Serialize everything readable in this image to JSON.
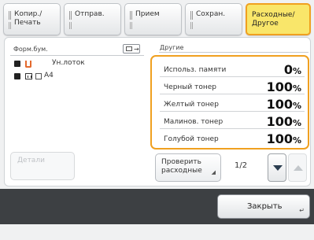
{
  "tabs": [
    {
      "line1": "Копир./",
      "line2": "Печать"
    },
    {
      "line1": "Отправ.",
      "line2": ""
    },
    {
      "line1": "Прием",
      "line2": ""
    },
    {
      "line1": "Сохран.",
      "line2": ""
    },
    {
      "line1": "Расходные/",
      "line2": "Другое"
    }
  ],
  "left_panel": {
    "title": "Форм.бум.",
    "trays": [
      {
        "label": "Ун.лоток"
      },
      {
        "label": "A4"
      }
    ],
    "details_label": "Детали"
  },
  "right_panel": {
    "title": "Другие",
    "rows": [
      {
        "name": "Использ. памяти",
        "value": "0",
        "unit": "%"
      },
      {
        "name": "Черный тонер",
        "value": "100",
        "unit": "%"
      },
      {
        "name": "Желтый тонер",
        "value": "100",
        "unit": "%"
      },
      {
        "name": "Малинов. тонер",
        "value": "100",
        "unit": "%"
      },
      {
        "name": "Голубой тонер",
        "value": "100",
        "unit": "%"
      }
    ],
    "check_label_1": "Проверить",
    "check_label_2": "расходные",
    "page": "1/2"
  },
  "close_label": "Закрыть",
  "colors": {
    "accent": "#f0a020",
    "active_tab": "#f9e66a",
    "bar": "#3d4043"
  }
}
